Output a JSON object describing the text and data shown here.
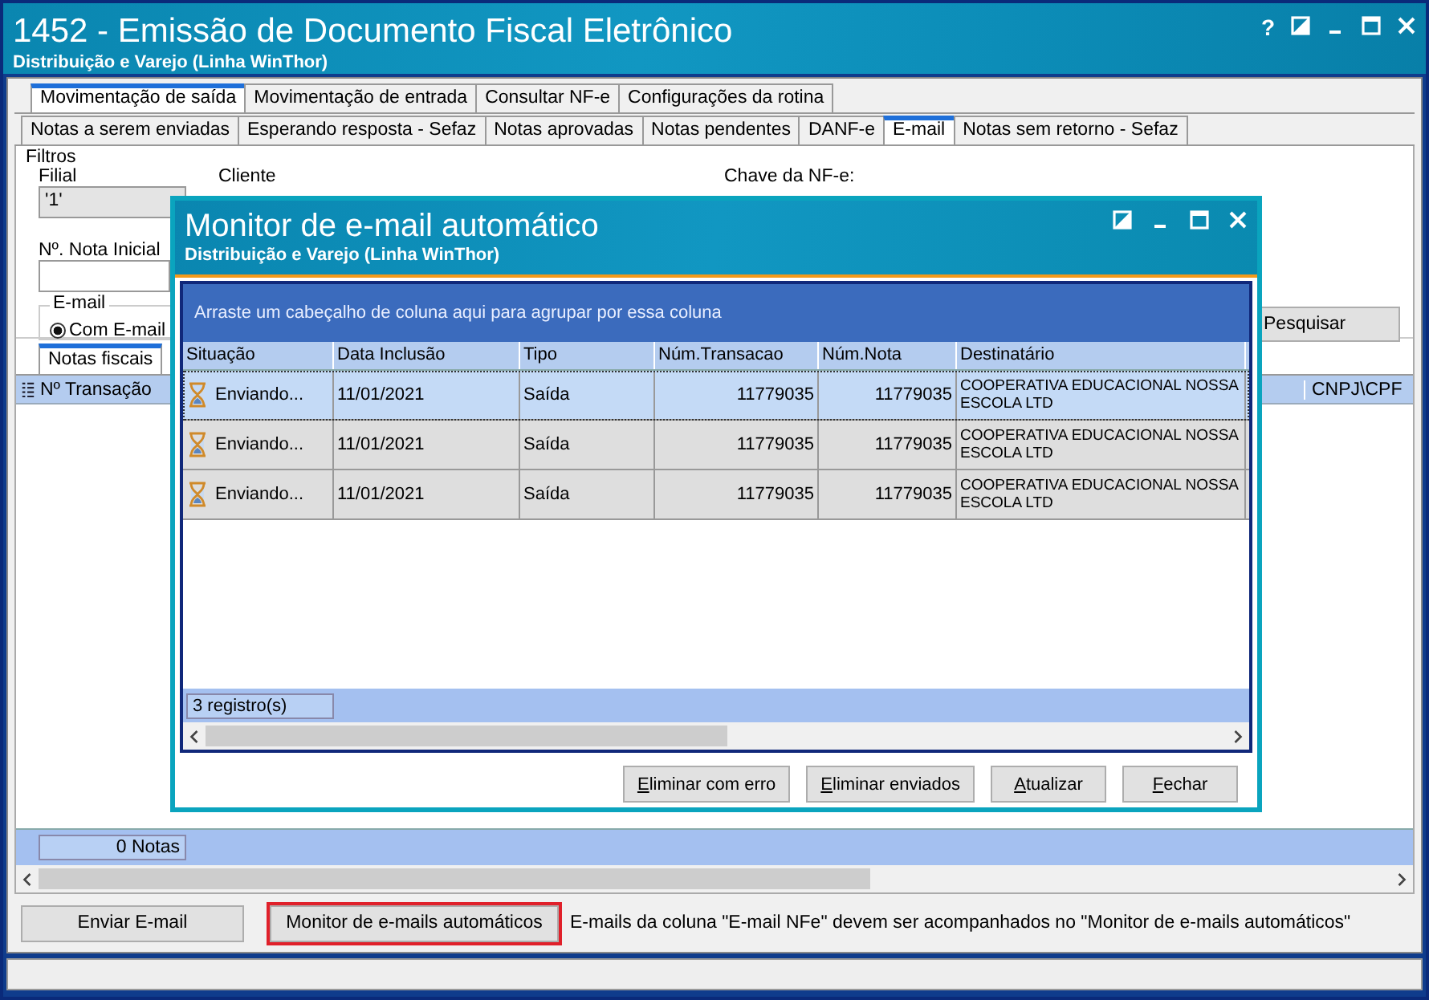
{
  "window": {
    "title": "1452 - Emissão de Documento Fiscal Eletrônico",
    "subtitle": "Distribuição e Varejo (Linha WinThor)",
    "help": "?"
  },
  "main_tabs": [
    {
      "label": "Movimentação de saída",
      "selected": true
    },
    {
      "label": "Movimentação de entrada",
      "selected": false
    },
    {
      "label": "Consultar NF-e",
      "selected": false
    },
    {
      "label": "Configurações da rotina",
      "selected": false
    }
  ],
  "sub_tabs": [
    {
      "label": "Notas a serem enviadas",
      "selected": false
    },
    {
      "label": "Esperando resposta - Sefaz",
      "selected": false
    },
    {
      "label": "Notas aprovadas",
      "selected": false
    },
    {
      "label": "Notas pendentes",
      "selected": false
    },
    {
      "label": "DANF-e",
      "selected": false
    },
    {
      "label": "E-mail",
      "selected": true
    },
    {
      "label": "Notas sem retorno - Sefaz",
      "selected": false
    }
  ],
  "filters": {
    "title": "Filtros",
    "filial_label": "Filial",
    "filial_value": "'1'",
    "cliente_label": "Cliente",
    "chave_label": "Chave da NF-e:",
    "nota_label": "Nº. Nota Inicial",
    "email_group": "E-mail",
    "email_option": {
      "label": "Com E-mail",
      "checked": true
    },
    "search_button": "Pesquisar"
  },
  "lower_tabs": [
    {
      "label": "Notas fiscais",
      "selected": true
    }
  ],
  "grid": {
    "columns": [
      "Nº Transação",
      "CNPJ\\CPF"
    ],
    "footer": "0 Notas"
  },
  "buttons": [
    {
      "label": "Enviar E-mail",
      "highlighted": false
    },
    {
      "label": "Monitor de e-mails automáticos",
      "highlighted": true
    }
  ],
  "note": "E-mails da coluna \"E-mail NFe\" devem ser acompanhados no \"Monitor de e-mails automáticos\"",
  "dialog": {
    "title": "Monitor de e-mail automático",
    "subtitle": "Distribuição e Varejo (Linha WinThor)",
    "group_hint": "Arraste um cabeçalho de coluna aqui para agrupar por essa coluna",
    "columns": [
      "Situação",
      "Data Inclusão",
      "Tipo",
      "Núm.Transacao",
      "Núm.Nota",
      "Destinatário"
    ],
    "rows": [
      {
        "selected": true,
        "cells": [
          "Enviando...",
          "11/01/2021",
          "Saída",
          "11779035",
          "11779035",
          "COOPERATIVA EDUCACIONAL NOSSA ESCOLA LTD"
        ]
      },
      {
        "selected": false,
        "cells": [
          "Enviando...",
          "11/01/2021",
          "Saída",
          "11779035",
          "11779035",
          "COOPERATIVA EDUCACIONAL NOSSA ESCOLA LTD"
        ]
      },
      {
        "selected": false,
        "cells": [
          "Enviando...",
          "11/01/2021",
          "Saída",
          "11779035",
          "11779035",
          "COOPERATIVA EDUCACIONAL NOSSA ESCOLA LTD"
        ]
      }
    ],
    "count": "3 registro(s)",
    "buttons": [
      "Eliminar com erro",
      "Eliminar enviados",
      "Atualizar",
      "Fechar"
    ]
  }
}
